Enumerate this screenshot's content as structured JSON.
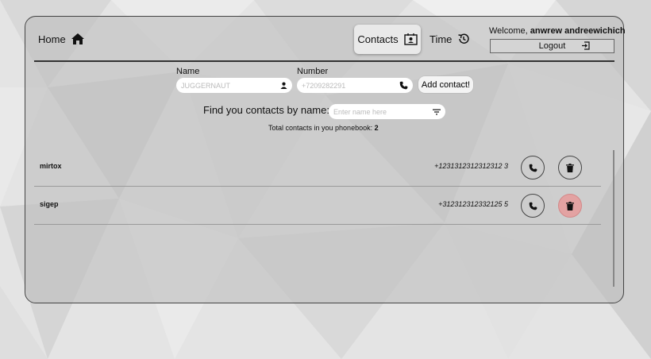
{
  "nav": {
    "home_label": "Home",
    "contacts_label": "Contacts",
    "time_label": "Time"
  },
  "user": {
    "welcome_prefix": "Welcome,",
    "username": "anwrew andreewichich",
    "logout_label": "Logout"
  },
  "form": {
    "name_label": "Name",
    "name_placeholder": "JUGGERNAUT",
    "number_label": "Number",
    "number_placeholder": "+7209282291",
    "add_label": "Add contact!"
  },
  "filter": {
    "label": "Find you contacts by name:",
    "placeholder": "Enter name here"
  },
  "stats": {
    "total_label": "Total contacts in you phonebook:",
    "total": "2"
  },
  "contacts": [
    {
      "name": "mirtox",
      "number": "+1231312312312312 3"
    },
    {
      "name": "sigep",
      "number": "+312312312332125 5"
    }
  ],
  "colors": {
    "delete_hover": "#e3a2a2",
    "card_bg": "#bebebe"
  },
  "icons": {
    "home": "home-icon",
    "contacts": "contact-card-icon",
    "time": "clock-history-icon",
    "logout": "logout-icon",
    "user": "user-icon",
    "phone": "phone-icon",
    "filter": "filter-icon",
    "trash": "trash-icon"
  }
}
